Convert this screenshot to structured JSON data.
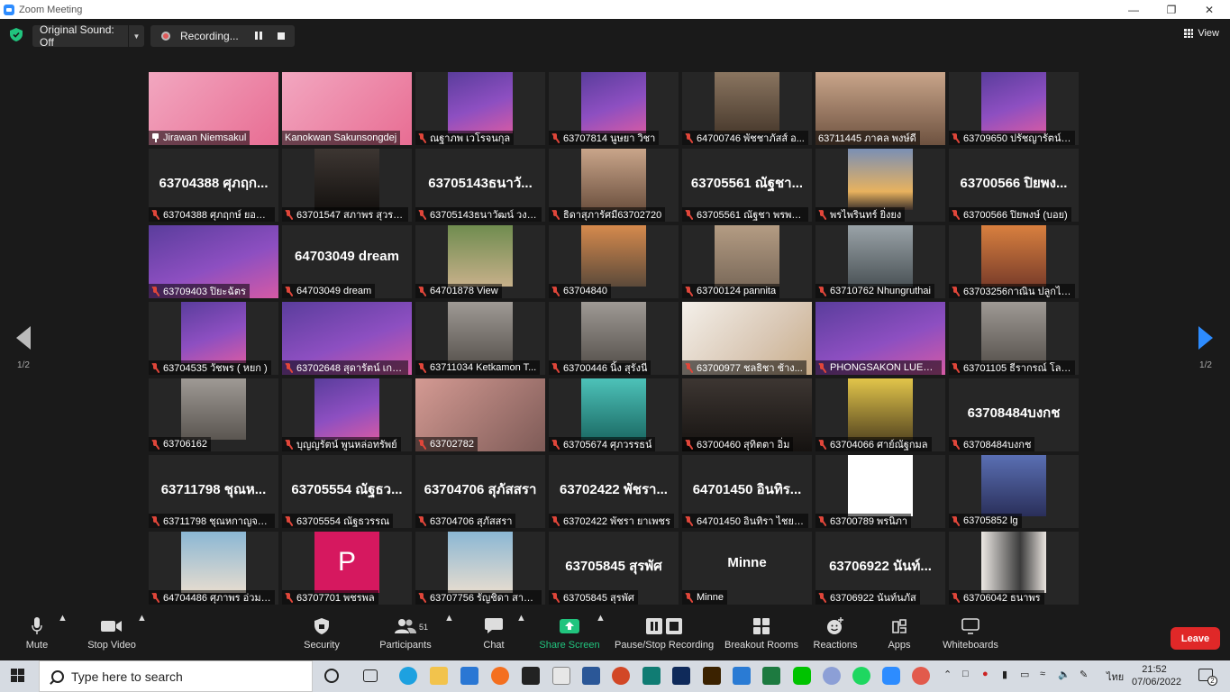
{
  "window": {
    "title": "Zoom Meeting"
  },
  "topbar": {
    "original_sound": "Original Sound: Off",
    "recording": "Recording...",
    "view": "View"
  },
  "pager": {
    "left": "1/2",
    "right": "1/2"
  },
  "tiles": [
    {
      "name": "Jirawan Niemsakul",
      "big": "",
      "video": "c-pink",
      "pin": true,
      "active": true
    },
    {
      "name": "Kanokwan Sakunsongdej",
      "big": "",
      "video": "c-pink",
      "pin": false,
      "nomic": true
    },
    {
      "name": "ณฐาภพ เวโรจนกุล",
      "big": "",
      "video": "c-purple"
    },
    {
      "name": "63707814 นูษยา วิชา",
      "big": "",
      "video": "c-purple"
    },
    {
      "name": "64700746 พัชชาภัสส์ อ...",
      "big": "",
      "video": "c-room"
    },
    {
      "name": "63711445 ภาคล พงษ์ดี",
      "big": "",
      "video": "c-face",
      "nomic": true
    },
    {
      "name": "63709650 ปรัชญารัตน์ บุญรั...",
      "big": "",
      "video": "c-purple"
    },
    {
      "name": "63704388 ศุภฤกษ์ ยอดอ...",
      "big": "63704388 ศุภฤก...",
      "video": ""
    },
    {
      "name": "63701547 สภาพร สุวรร...",
      "big": "",
      "video": "c-dark"
    },
    {
      "name": "63705143ธนาวัฒน์ วงษ์...",
      "big": "63705143ธนาวั...",
      "video": ""
    },
    {
      "name": "ธิดาสุภารัศมี63702720",
      "big": "",
      "video": "c-face"
    },
    {
      "name": "63705561 ณัฐชา พรพร...",
      "big": "63705561 ณัฐชา...",
      "video": ""
    },
    {
      "name": "พรไพรินทร์ ยิ่งยง",
      "big": "",
      "video": "c-sky"
    },
    {
      "name": "63700566 ปิยพงษ์ (บอย)",
      "big": "63700566 ปิยพง...",
      "video": ""
    },
    {
      "name": "63709403 ปิยะฉัตร",
      "big": "",
      "video": "c-purple"
    },
    {
      "name": "64703049 dream",
      "big": "64703049 dream",
      "video": ""
    },
    {
      "name": "64701878 View",
      "big": "",
      "video": "c-beach"
    },
    {
      "name": "63704840",
      "big": "",
      "video": "c-sunset"
    },
    {
      "name": "63700124 pannita",
      "big": "",
      "video": "c-shelf"
    },
    {
      "name": "63710762 Nhungruthai",
      "big": "",
      "video": "c-mono"
    },
    {
      "name": "63703256กาณิน ปลูกไม้ดี",
      "big": "",
      "video": "c-bridge"
    },
    {
      "name": "63704535 วัชพร ( หยก )",
      "big": "",
      "video": "c-purple"
    },
    {
      "name": "63702648 สุดารัตน์ เกษ...",
      "big": "",
      "video": "c-purple"
    },
    {
      "name": "63711034 Ketkamon T...",
      "big": "",
      "video": "c-grey"
    },
    {
      "name": "63700446 นิ้ง สุรังนี",
      "big": "",
      "video": "c-grey"
    },
    {
      "name": "63700977 ชลธิชา ช้าง...",
      "big": "",
      "video": "c-bright"
    },
    {
      "name": "PHONGSAKON LUESO...",
      "big": "",
      "video": "c-purple"
    },
    {
      "name": "63701105 ธีรากรณ์ โลม...",
      "big": "",
      "video": "c-grey"
    },
    {
      "name": "63706162",
      "big": "",
      "video": "c-grey"
    },
    {
      "name": "บุญญรัตน์ พูนหล่อทรัพย์",
      "big": "",
      "video": "c-purple"
    },
    {
      "name": "63702782",
      "big": "",
      "video": "c-pinkroom"
    },
    {
      "name": "63705674 ศุภวรรธน์",
      "big": "",
      "video": "c-teal"
    },
    {
      "name": "63700460 สุทิตตา อิ่ม",
      "big": "",
      "video": "c-dark"
    },
    {
      "name": "63704066 ศาย์ณัฐกมล",
      "big": "",
      "video": "c-yellow"
    },
    {
      "name": "63708484บงกช",
      "big": "63708484บงกช",
      "video": ""
    },
    {
      "name": "63711798 ชุณหกาญจน์...",
      "big": "63711798 ชุณห...",
      "video": ""
    },
    {
      "name": "63705554 ณัฐธวรรณ",
      "big": "63705554 ณัฐธว...",
      "video": ""
    },
    {
      "name": "63704706 สุภัสสรา",
      "big": "63704706 สุภัสสรา",
      "video": ""
    },
    {
      "name": "63702422 พัชรา ยาเพชร",
      "big": "63702422 พัชรา...",
      "video": ""
    },
    {
      "name": "64701450 อินทิรา ไชยา...",
      "big": "64701450 อินทิร...",
      "video": ""
    },
    {
      "name": "63700789 พรนิภา",
      "big": "",
      "video": "c-white"
    },
    {
      "name": "63705852 lg",
      "big": "",
      "video": "c-blueblur"
    },
    {
      "name": "64704486 ศุภาพร อ่วมสั...",
      "big": "",
      "video": "c-sea"
    },
    {
      "name": "63707701 พชรพล",
      "big": "",
      "video": "c-magenta",
      "letter": "P"
    },
    {
      "name": "63707756 รัญชิดา สาธิต...",
      "big": "",
      "video": "c-sea"
    },
    {
      "name": "63705845 สุรพัศ",
      "big": "63705845 สุรพัศ",
      "video": ""
    },
    {
      "name": "Minne",
      "big": "Minne",
      "video": ""
    },
    {
      "name": "63706922 นันท์นภัส",
      "big": "63706922 นันท์...",
      "video": ""
    },
    {
      "name": "63706042 ธนาพร",
      "big": "",
      "video": "c-suit"
    }
  ],
  "toolbar": {
    "mute": "Mute",
    "stop_video": "Stop Video",
    "security": "Security",
    "participants": "Participants",
    "participants_count": "51",
    "chat": "Chat",
    "share_screen": "Share Screen",
    "pause_stop_recording": "Pause/Stop Recording",
    "breakout_rooms": "Breakout Rooms",
    "reactions": "Reactions",
    "apps": "Apps",
    "whiteboards": "Whiteboards",
    "leave": "Leave"
  },
  "taskbar": {
    "search_placeholder": "Type here to search",
    "lang": "ไทย",
    "time": "21:52",
    "date": "07/06/2022",
    "notifications": "2"
  },
  "colors": {
    "accent": "#2d8cff",
    "share": "#21c47e",
    "leave": "#e02828",
    "mic_off": "#e0463a"
  }
}
